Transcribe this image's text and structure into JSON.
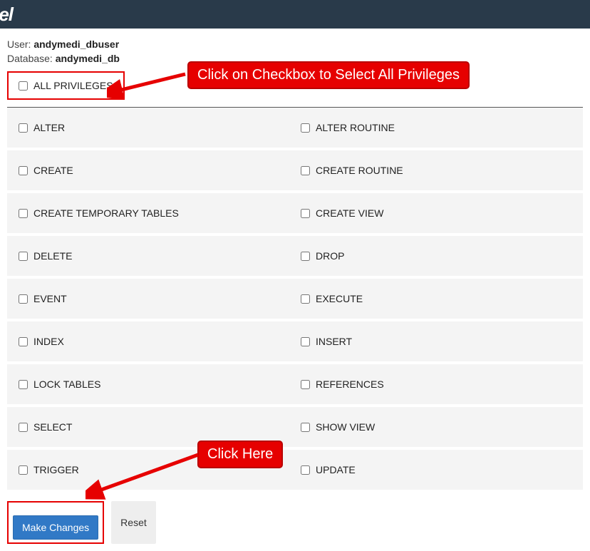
{
  "header": {
    "logo_fragment": "anel"
  },
  "meta": {
    "user_label": "User: ",
    "user_value": "andymedi_dbuser",
    "db_label": "Database: ",
    "db_value": "andymedi_db"
  },
  "all_priv_label": "ALL PRIVILEGES",
  "privileges": [
    {
      "left": "ALTER",
      "right": "ALTER ROUTINE"
    },
    {
      "left": "CREATE",
      "right": "CREATE ROUTINE"
    },
    {
      "left": "CREATE TEMPORARY TABLES",
      "right": "CREATE VIEW"
    },
    {
      "left": "DELETE",
      "right": "DROP"
    },
    {
      "left": "EVENT",
      "right": "EXECUTE"
    },
    {
      "left": "INDEX",
      "right": "INSERT"
    },
    {
      "left": "LOCK TABLES",
      "right": "REFERENCES"
    },
    {
      "left": "SELECT",
      "right": "SHOW VIEW"
    },
    {
      "left": "TRIGGER",
      "right": "UPDATE"
    }
  ],
  "buttons": {
    "make_changes": "Make Changes",
    "reset": "Reset"
  },
  "annotations": {
    "callout1": "Click on Checkbox to Select All Privileges",
    "callout2": "Click Here"
  }
}
